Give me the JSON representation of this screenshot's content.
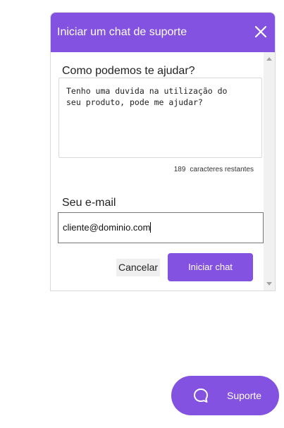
{
  "chat_window": {
    "title": "Iniciar um chat de suporte",
    "close_icon": "close-icon",
    "help_label": "Como podemos te ajudar?",
    "message_value": "Tenho uma duvida na utilização do\nseu produto, pode me ajudar?",
    "chars_remaining": "189",
    "chars_remaining_label": "caracteres restantes",
    "email_label": "Seu e-mail",
    "email_value": "cliente@dominio.com",
    "cancel_label": "Cancelar",
    "start_label": "Iniciar chat"
  },
  "launcher": {
    "label": "Suporte",
    "icon": "chat-bubble-icon"
  },
  "colors": {
    "accent": "#8352e0",
    "white": "#ffffff"
  }
}
